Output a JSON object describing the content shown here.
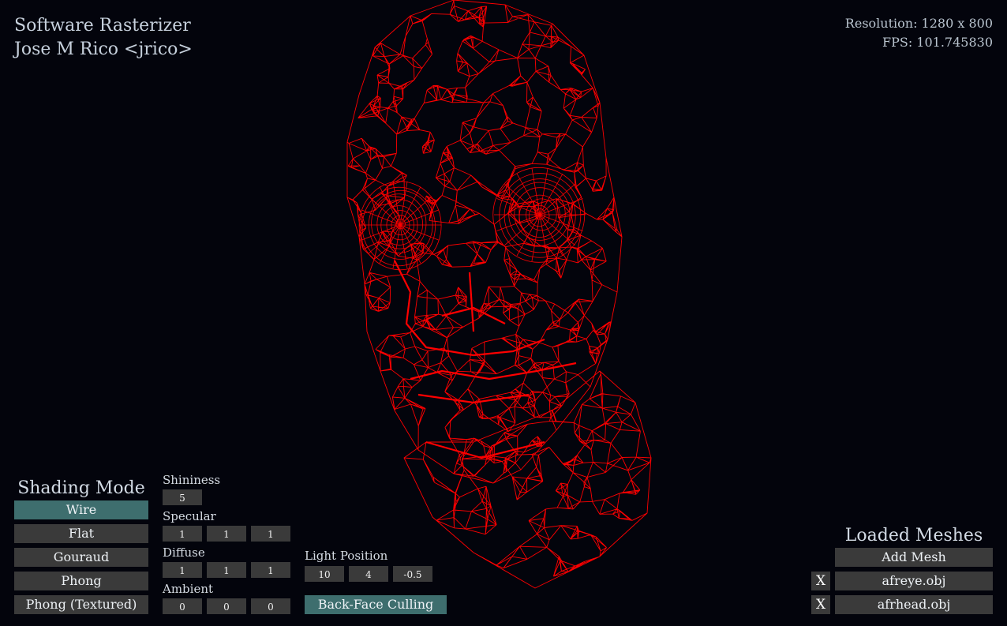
{
  "app": {
    "title": "Software Rasterizer",
    "author": "Jose M Rico <jrico>"
  },
  "stats": {
    "resolution_label": "Resolution: 1280 x 800",
    "fps_label": "FPS: 101.745830"
  },
  "viewport": {
    "render_mode": "wireframe",
    "wire_color": "#ff0000",
    "background": "#03040c",
    "model": "head mesh with eyes"
  },
  "shading": {
    "heading": "Shading Mode",
    "modes": [
      "Wire",
      "Flat",
      "Gouraud",
      "Phong",
      "Phong (Textured)"
    ],
    "selected": "Wire",
    "active_color": "#3e6e6e"
  },
  "material": {
    "shininess": {
      "label": "Shininess",
      "value": "5"
    },
    "specular": {
      "label": "Specular",
      "values": [
        "1",
        "1",
        "1"
      ]
    },
    "diffuse": {
      "label": "Diffuse",
      "values": [
        "1",
        "1",
        "1"
      ]
    },
    "ambient": {
      "label": "Ambient",
      "values": [
        "0",
        "0",
        "0"
      ]
    }
  },
  "light": {
    "label": "Light Position",
    "values": [
      "10",
      "4",
      "-0.5"
    ]
  },
  "culling": {
    "label": "Back-Face Culling",
    "enabled": true
  },
  "meshes": {
    "heading": "Loaded Meshes",
    "add_label": "Add Mesh",
    "remove_label": "X",
    "items": [
      "afreye.obj",
      "afrhead.obj"
    ]
  }
}
